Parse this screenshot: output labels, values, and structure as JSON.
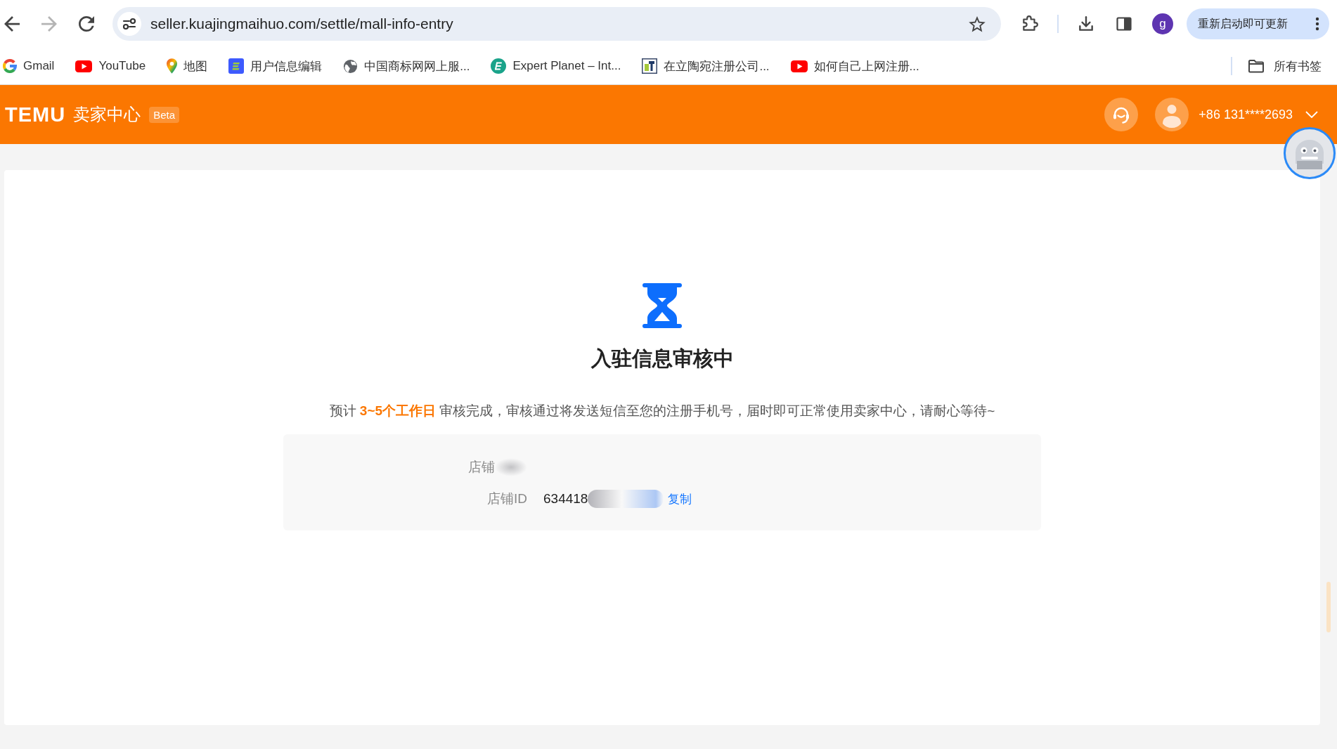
{
  "browser": {
    "nav_buttons": [
      {
        "kind": "back",
        "disabled": false
      },
      {
        "kind": "forward",
        "disabled": true
      },
      {
        "kind": "reload",
        "disabled": false
      }
    ],
    "url": "seller.kuajingmaihuo.com/settle/mall-info-entry",
    "profile_initial": "g",
    "update_button": "重新启动即可更新",
    "bookmarks": [
      {
        "label": "Gmail",
        "kind": "google"
      },
      {
        "label": "YouTube",
        "kind": "video"
      },
      {
        "label": "地图",
        "kind": "pin"
      },
      {
        "label": "用户信息编辑",
        "kind": "tile"
      },
      {
        "label": "中国商标网网上服...",
        "kind": "globe"
      },
      {
        "label": "Expert Planet – Int...",
        "kind": "circle"
      },
      {
        "label": "在立陶宛注册公司...",
        "kind": "square"
      },
      {
        "label": "如何自己上网注册...",
        "kind": "video"
      }
    ],
    "all_bookmarks": "所有书签"
  },
  "header": {
    "logo": "TEMU",
    "title": "卖家中心",
    "badge": "Beta",
    "phone": "+86 131****2693"
  },
  "status": {
    "title": "入驻信息审核中",
    "message": "预计 **3~5个工作日** 审核完成，审核通过将发送短信至您的注册手机号，届时即可正常使用卖家中心，请耐心等待~"
  },
  "store_info": {
    "rows": [
      {
        "label": "店铺",
        "redacted": true
      },
      {
        "label": "店铺ID",
        "value": "634418",
        "redacted": true,
        "action": "复制"
      }
    ]
  }
}
